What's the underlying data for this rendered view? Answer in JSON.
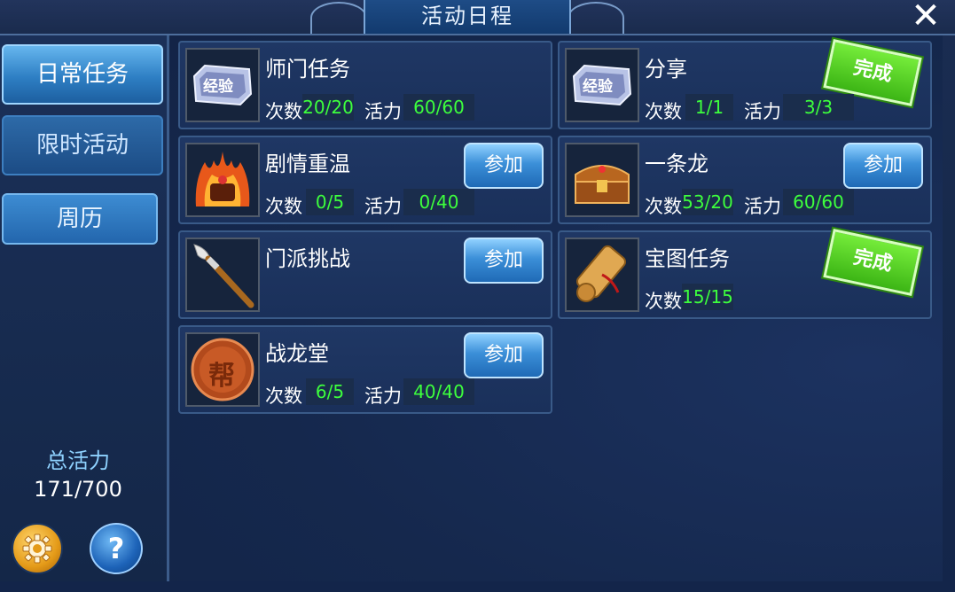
{
  "window": {
    "title": "活动日程",
    "close_glyph": "✕"
  },
  "sidebar": {
    "tabs": [
      {
        "label": "日常任务"
      },
      {
        "label": "限时活动"
      },
      {
        "label": "周历"
      }
    ],
    "total_label": "总活力",
    "total_value": "171/700",
    "help_glyph": "?"
  },
  "labels": {
    "count": "次数",
    "vitality": "活力",
    "join": "参加",
    "done": "完成",
    "exp_badge": "经验",
    "guild_char": "帮"
  },
  "tasks": [
    {
      "title": "师门任务",
      "count": "20/20",
      "vitality": "60/60",
      "status": "none",
      "icon": "exp-scroll-icon"
    },
    {
      "title": "分享",
      "count": "1/1",
      "vitality": "3/3",
      "status": "done",
      "icon": "exp-scroll-icon"
    },
    {
      "title": "剧情重温",
      "count": "0/5",
      "vitality": "0/40",
      "status": "join",
      "icon": "flame-helmet-icon"
    },
    {
      "title": "一条龙",
      "count": "53/20",
      "vitality": "60/60",
      "status": "join",
      "icon": "treasure-chest-icon"
    },
    {
      "title": "门派挑战",
      "status": "join",
      "icon": "spear-icon"
    },
    {
      "title": "宝图任务",
      "count": "15/15",
      "status": "done",
      "icon": "treasure-map-icon"
    },
    {
      "title": "战龙堂",
      "count": "6/5",
      "vitality": "40/40",
      "status": "join",
      "icon": "guild-coin-icon"
    }
  ]
}
